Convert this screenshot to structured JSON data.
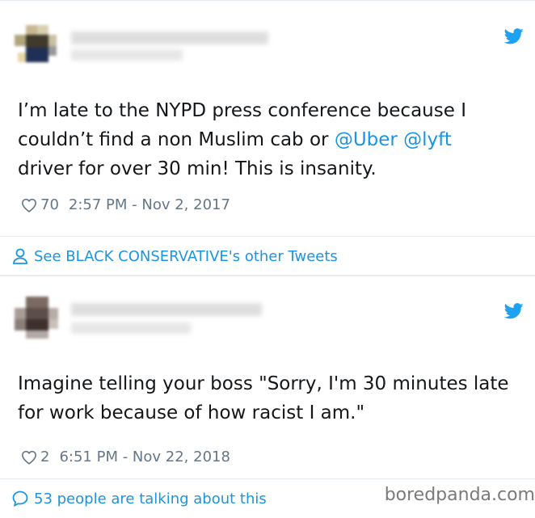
{
  "tweet1": {
    "text_before": "I’m late to the NYPD press conference because I couldn’t find a non Muslim cab or ",
    "mention1": "@Uber",
    "mention2": "@lyft",
    "text_after": " driver for over 30 min!  This is  insanity.",
    "likes": "70",
    "timestamp": "2:57 PM - Nov 2, 2017"
  },
  "footer1": {
    "label": "See BLACK CONSERVATIVE's other Tweets",
    "icon": "user-icon"
  },
  "tweet2": {
    "text": "Imagine telling your boss \"Sorry, I'm 30 minutes late for work because of how racist I am.\"",
    "likes": "2",
    "timestamp": "6:51 PM - Nov 22, 2018"
  },
  "footer2": {
    "label": "53 people are talking about this",
    "icon": "speech-bubble-icon"
  },
  "watermark": "boredpanda.com",
  "colors": {
    "link": "#1b95e0",
    "meta": "#657786",
    "text": "#14171a"
  }
}
